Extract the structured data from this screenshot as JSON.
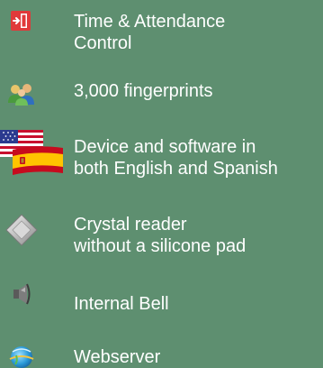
{
  "features": [
    {
      "icon": "exit-door-icon",
      "lines": [
        "Time & Attendance",
        "Control"
      ]
    },
    {
      "icon": "users-group-icon",
      "lines": [
        "3,000 fingerprints"
      ]
    },
    {
      "icon": "us-spain-flags-icon",
      "lines": [
        "Device and software in",
        "both English and Spanish"
      ]
    },
    {
      "icon": "crystal-diamond-icon",
      "lines": [
        "Crystal reader",
        "without a silicone pad"
      ]
    },
    {
      "icon": "speaker-bell-icon",
      "lines": [
        "Internal Bell"
      ]
    },
    {
      "icon": "internet-globe-icon",
      "lines": [
        "Webserver"
      ]
    }
  ],
  "colors": {
    "background": "#5e8f70",
    "text": "#ffffff"
  }
}
